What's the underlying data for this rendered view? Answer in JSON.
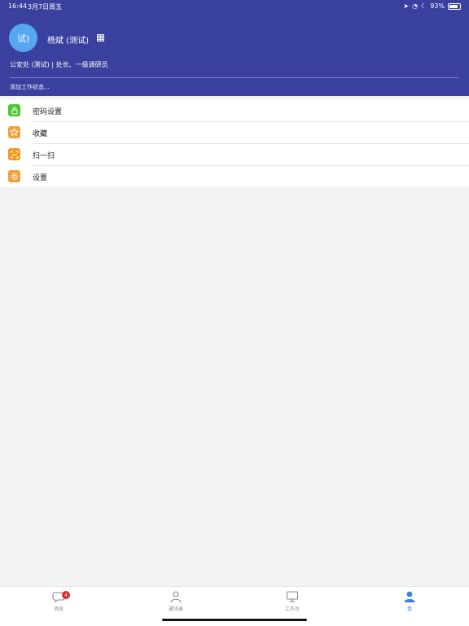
{
  "status_bar": {
    "time": "16:44",
    "date": "3月7日周五",
    "battery_text": "93%"
  },
  "profile": {
    "avatar_text": "试)",
    "name": "杨斌 (测试)",
    "department": "公安处 (测试) | 处长、一级调研员",
    "work_status_placeholder": "添加工作状态..."
  },
  "menu": [
    {
      "label": "密码设置",
      "icon": "lock-icon",
      "color": "#4cc72f"
    },
    {
      "label": "收藏",
      "icon": "star-icon",
      "color": "#f2a23a"
    },
    {
      "label": "扫一扫",
      "icon": "scan-icon",
      "color": "#f29b21"
    },
    {
      "label": "设置",
      "icon": "gear-icon",
      "color": "#f0a03c"
    }
  ],
  "tabbar": {
    "messages": {
      "label": "消息",
      "badge": "4"
    },
    "contacts": {
      "label": "通讯录"
    },
    "workbench": {
      "label": "工作台"
    },
    "me": {
      "label": "我",
      "active": true
    }
  },
  "colors": {
    "header": "#39409e",
    "avatar": "#57a6f2",
    "active_tab": "#3b7fe3",
    "badge": "#e02c2c"
  }
}
